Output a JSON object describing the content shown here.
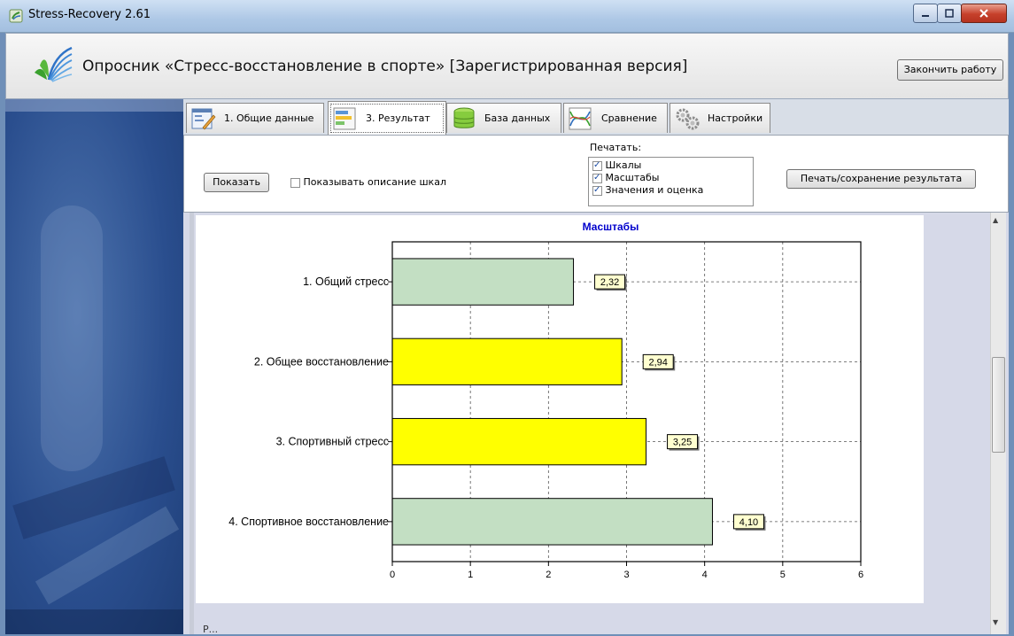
{
  "window": {
    "title": "Stress-Recovery 2.61"
  },
  "header": {
    "title": "Опросник «Стресс-восстановление в спорте» [Зарегистрированная версия]",
    "finish_label": "Закончить работу"
  },
  "tabs": [
    {
      "label": "1. Общие данные",
      "icon": "form-icon"
    },
    {
      "label": "3. Результат",
      "icon": "bar-chart-icon",
      "active": true
    },
    {
      "label": "База данных",
      "icon": "database-icon"
    },
    {
      "label": "Сравнение",
      "icon": "compare-lines-icon"
    },
    {
      "label": "Настройки",
      "icon": "gears-icon"
    }
  ],
  "controls": {
    "show_label": "Показать",
    "show_desc_label": "Показывать описание шкал",
    "show_desc_checked": false,
    "print_label": "Печатать:",
    "print_options": [
      {
        "label": "Шкалы",
        "checked": true
      },
      {
        "label": "Масштабы",
        "checked": true
      },
      {
        "label": "Значения и оценка",
        "checked": true
      }
    ],
    "print_save_label": "Печать/сохранение результата"
  },
  "colors": {
    "bar_green": "#c3dfc3",
    "bar_yellow": "#ffff00",
    "chart_title": "#0000cc",
    "label_bg": "#ffffd0"
  },
  "chart_data": {
    "type": "bar",
    "orientation": "horizontal",
    "title": "Масштабы",
    "categories": [
      "1. Общий стресс",
      "2. Общее восстановление",
      "3. Спортивный стресс",
      "4. Спортивное восстановление"
    ],
    "values": [
      2.32,
      2.94,
      3.25,
      4.1
    ],
    "value_labels": [
      "2,32",
      "2,94",
      "3,25",
      "4,10"
    ],
    "bar_colors": [
      "#c3dfc3",
      "#ffff00",
      "#ffff00",
      "#c3dfc3"
    ],
    "xlim": [
      0,
      6
    ],
    "xticks": [
      0,
      1,
      2,
      3,
      4,
      5,
      6
    ],
    "grid": true
  },
  "bottom": {
    "text": "Р..."
  }
}
